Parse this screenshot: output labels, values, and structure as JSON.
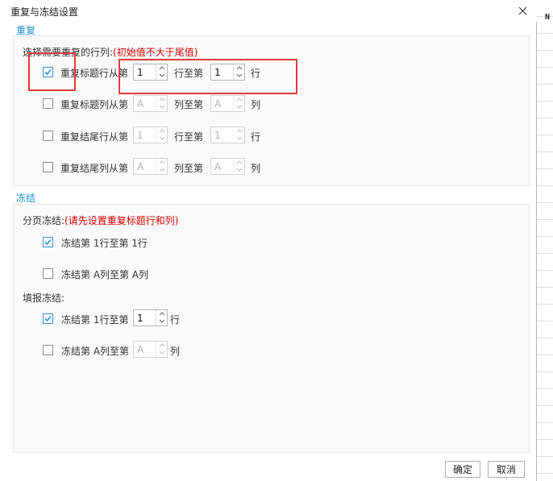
{
  "background": {
    "column_letter": "N"
  },
  "dialog": {
    "title": "重复与冻结设置",
    "close_icon": "close-icon"
  },
  "repeat": {
    "section_title": "重复",
    "prompt": "选择需要重复的行列:",
    "hint": "(初始值不大于尾值)",
    "rows": [
      {
        "label": "重复标题行从第",
        "checked": true,
        "from": "1",
        "mid": "行至第",
        "to": "1",
        "end": "行",
        "disabled": false
      },
      {
        "label": "重复标题列从第",
        "checked": false,
        "from": "A",
        "mid": "列至第",
        "to": "A",
        "end": "列",
        "disabled": true
      },
      {
        "label": "重复结尾行从第",
        "checked": false,
        "from": "1",
        "mid": "行至第",
        "to": "1",
        "end": "行",
        "disabled": true
      },
      {
        "label": "重复结尾列从第",
        "checked": false,
        "from": "A",
        "mid": "列至第",
        "to": "A",
        "end": "列",
        "disabled": true
      }
    ]
  },
  "freeze": {
    "section_title": "冻结",
    "page_freeze": {
      "label": "分页冻结:",
      "hint": "(请先设置重复标题行和列)",
      "items": [
        {
          "label": "冻结第 1行至第 1行",
          "checked": true
        },
        {
          "label": "冻结第 A列至第 A列",
          "checked": false
        }
      ]
    },
    "report_freeze": {
      "label": "填报冻结:",
      "items": [
        {
          "label": "冻结第 1行至第",
          "checked": true,
          "value": "1",
          "end": "行",
          "disabled": false
        },
        {
          "label": "冻结第 A列至第",
          "checked": false,
          "value": "A",
          "end": "列",
          "disabled": true
        }
      ]
    }
  },
  "footer": {
    "ok_label": "确定",
    "cancel_label": "取消"
  },
  "colors": {
    "accent": "#1e8fce",
    "checkbox_blue": "#2f8fdc",
    "hint_red": "#e00000",
    "highlight_red": "#e33b3b"
  }
}
